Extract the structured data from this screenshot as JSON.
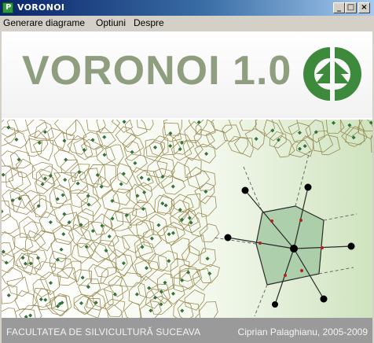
{
  "window": {
    "title": "VORONOI",
    "app_icon": "P",
    "buttons": {
      "minimize": "_",
      "maximize": "□",
      "close": "×"
    }
  },
  "menu": {
    "items": [
      "Generare diagrame",
      "Optiuni",
      "Despre"
    ]
  },
  "header": {
    "title": "VORONOI 1.0",
    "logo_icon": "forest-logo-icon"
  },
  "footer": {
    "left_text": "FACULTATEA DE SILVICULTURĂ SUCEAVA",
    "right_text": "Ciprian Palaghianu, 2005-2009"
  },
  "colors": {
    "title_bar_start": "#0a246a",
    "title_bar_end": "#a6caf0",
    "title_text": "#8f9e7f",
    "logo_green": "#3d8a3d",
    "footer_bg": "#9a9a9a",
    "cell_edges": "#8a7a3a",
    "site_points": "#2f7a3a"
  }
}
